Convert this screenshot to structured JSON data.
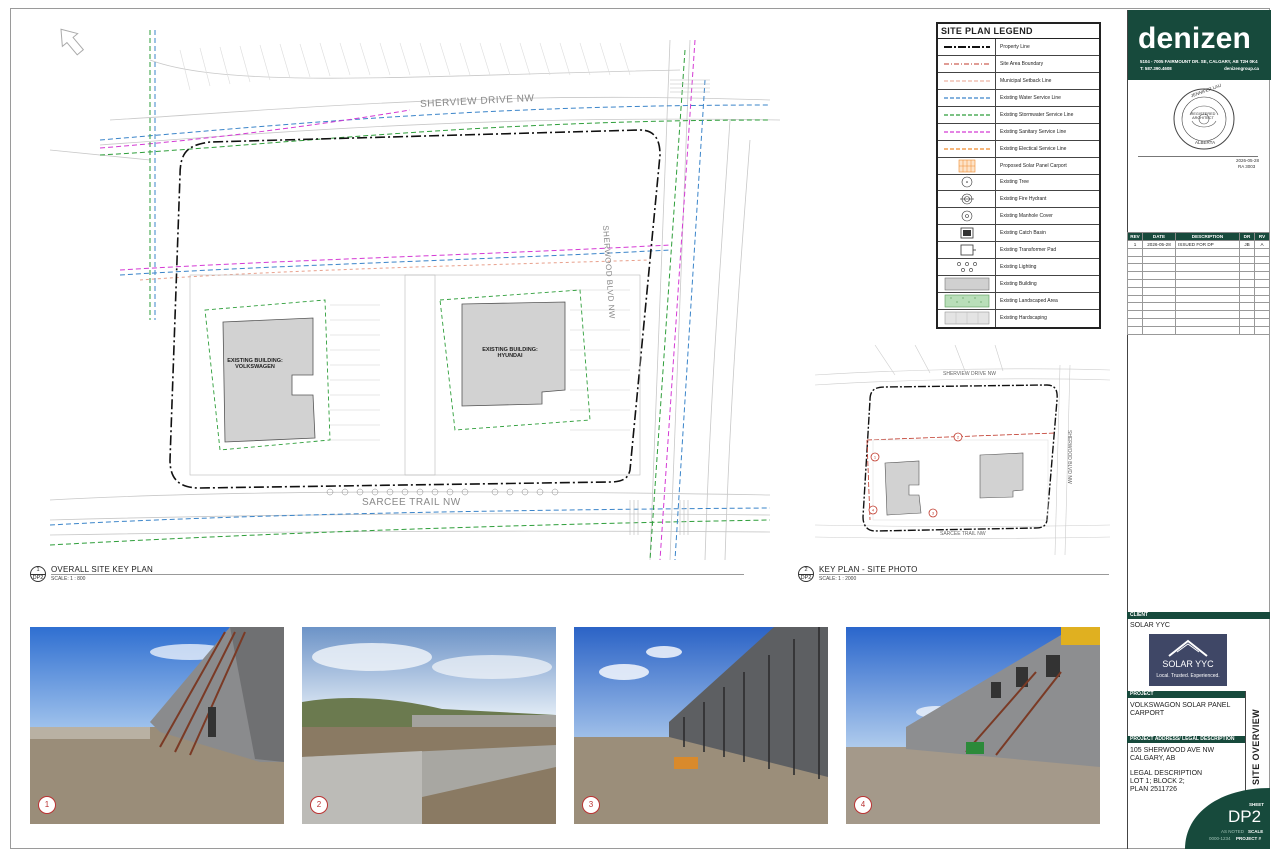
{
  "firm": {
    "name": "denizen",
    "address": "5104 - 7005 FAIRMOUNT DR. SE, CALGARY, AB T2H 0K4",
    "phone": "T: 587.390.4608",
    "website": "denizengroup.ca"
  },
  "stamp": {
    "text_top": "JENNIFER LAU",
    "text_mid": "REGISTERED ARCHITECT",
    "text_bottom": "ALBERTA",
    "date": "2026-05-28",
    "number": "RA 3003"
  },
  "revisions": {
    "headers": [
      "REV",
      "DATE",
      "DESCRIPTION",
      "DR",
      "RV"
    ],
    "rows": [
      [
        "1",
        "2026-05-28",
        "ISSUED FOR DP",
        "JB",
        "A"
      ]
    ]
  },
  "client": {
    "section_label": "CLIENT",
    "name": "SOLAR YYC",
    "logo_text": "SOLAR YYC",
    "logo_tagline": "Local. Trusted. Experienced."
  },
  "project": {
    "section_label": "PROJECT",
    "name_line1": "VOLKSWAGON SOLAR PANEL",
    "name_line2": "CARPORT"
  },
  "address": {
    "section_label": "PROJECT ADDRESS/ LEGAL DESCRIPTION",
    "line1": "105 SHERWOOD AVE NW",
    "line2": "CALGARY, AB",
    "legal_heading": "LEGAL DESCRIPTION",
    "legal_line1": "LOT 1; BLOCK 2;",
    "legal_line2": "PLAN 2511726"
  },
  "sheet": {
    "title": "SITE OVERVIEW",
    "label": "SHEET",
    "number": "DP2",
    "scale_value": "AS NOTED",
    "scale_label": "SCALE",
    "project_no": "0000-1234",
    "project_label": "PROJECT #"
  },
  "legend": {
    "title": "SITE PLAN LEGEND",
    "items": [
      {
        "label": "Property Line",
        "symbol": "property-line",
        "color": "#111111"
      },
      {
        "label": "Site Area Boundary",
        "symbol": "site-boundary",
        "color": "#c0392b"
      },
      {
        "label": "Municipal Setback Line",
        "symbol": "setback-line",
        "color": "#e8a08c"
      },
      {
        "label": "Existing Water Service Line",
        "symbol": "water-line",
        "color": "#3a84c9"
      },
      {
        "label": "Existing Stormwater Service Line",
        "symbol": "storm-line",
        "color": "#2e9e3a"
      },
      {
        "label": "Existing Sanitary Service Line",
        "symbol": "sanitary-line",
        "color": "#d43ad4"
      },
      {
        "label": "Existing Electical Service Line",
        "symbol": "electrical-line",
        "color": "#f08a2c"
      },
      {
        "label": "Proposed Solar Panel Carport",
        "symbol": "solar-carport",
        "color": "#f08a2c"
      },
      {
        "label": "Existing Tree",
        "symbol": "tree-icon",
        "color": "#333333"
      },
      {
        "label": "Existing Fire Hydrant",
        "symbol": "hydrant-icon",
        "color": "#333333"
      },
      {
        "label": "Existing Manhole Cover",
        "symbol": "manhole-icon",
        "color": "#333333"
      },
      {
        "label": "Existing Catch Basin",
        "symbol": "catch-basin-icon",
        "color": "#333333"
      },
      {
        "label": "Existing Transformer Pad",
        "symbol": "transformer-icon",
        "color": "#333333"
      },
      {
        "label": "Existing Lighting",
        "symbol": "lighting-icon",
        "color": "#333333"
      },
      {
        "label": "Existing Building",
        "symbol": "building-fill",
        "color": "#d0d0d0"
      },
      {
        "label": "Existing Landscaped Area",
        "symbol": "landscape-fill",
        "color": "#b9dfb9"
      },
      {
        "label": "Existing Hardscaping",
        "symbol": "hardscape-fill",
        "color": "#e4e4e4"
      }
    ]
  },
  "site_plan": {
    "street_north": "SHERVIEW DRIVE NW",
    "street_south": "SARCEE TRAIL NW",
    "street_east": "SHERWOOD BLVD NW",
    "building_1": "EXISTING BUILDING:",
    "building_1_name": "VOLKSWAGEN",
    "building_2": "EXISTING BUILDING:",
    "building_2_name": "HYUNDAI"
  },
  "views": [
    {
      "num": "1",
      "sheet": "DP2",
      "title": "OVERALL SITE KEY PLAN",
      "scale": "SCALE:  1 : 800"
    },
    {
      "num": "2",
      "sheet": "DP2",
      "title": "KEY PLAN - SITE PHOTO",
      "scale": "SCALE:  1 : 2000"
    }
  ],
  "key_plan": {
    "street_north": "SHERVIEW DRIVE NW",
    "street_south": "SARCEE TRAIL NW",
    "street_east": "SHERWOOD BLVD NW"
  },
  "photos": [
    {
      "num": "1"
    },
    {
      "num": "2"
    },
    {
      "num": "3"
    },
    {
      "num": "4"
    }
  ]
}
